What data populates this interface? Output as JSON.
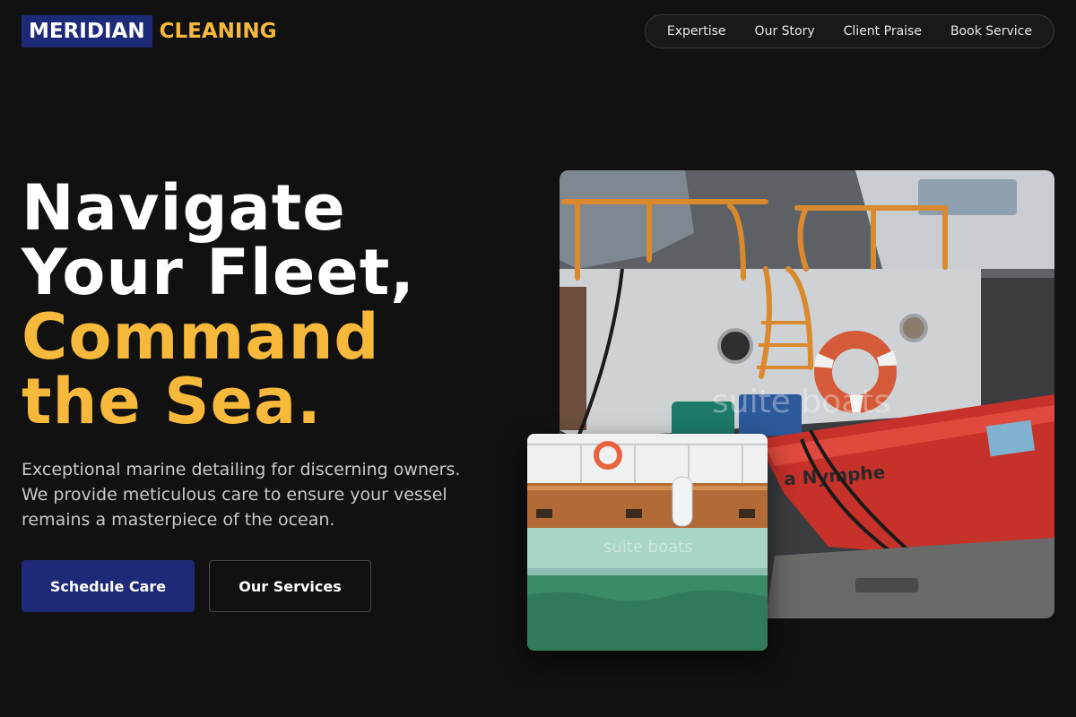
{
  "header": {
    "logo_primary": "MERIDIAN",
    "logo_accent": "CLEANING",
    "nav": [
      "Expertise",
      "Our Story",
      "Client Praise",
      "Book Service"
    ]
  },
  "hero": {
    "headline_line1": "Navigate",
    "headline_line2": "Your Fleet,",
    "headline_line3": "Command",
    "headline_line4": "the Sea.",
    "lede": "Exceptional marine detailing for discerning owners. We provide meticulous care to ensure your vessel remains a masterpiece of the ocean.",
    "primary_cta": "Schedule Care",
    "secondary_cta": "Our Services"
  },
  "images": {
    "main_watermark": "suite boats",
    "main_boat_name": "a Nymphe",
    "small_watermark": "suite boats"
  },
  "colors": {
    "background": "#111112",
    "brand_navy": "#1e2a78",
    "accent_gold": "#f6b93b"
  }
}
